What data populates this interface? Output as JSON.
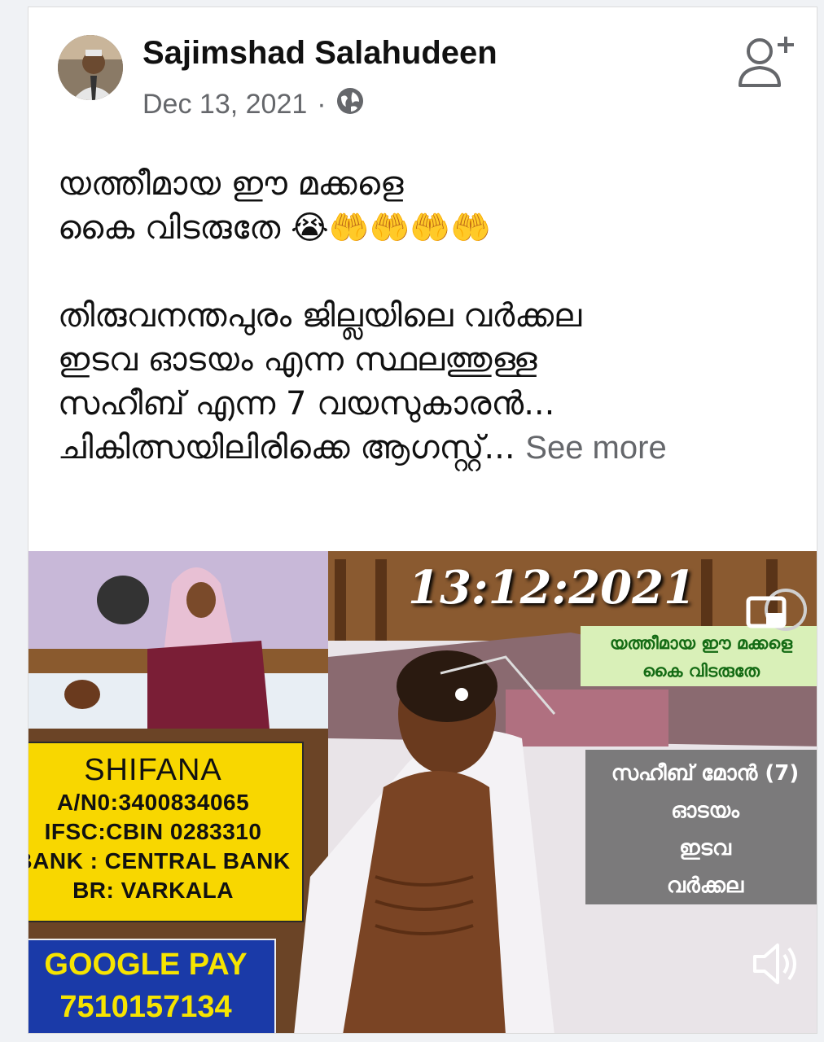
{
  "post": {
    "author": "Sajimshad Salahudeen",
    "date": "Dec 13, 2021",
    "separator": "·",
    "text_lines": [
      "യത്തീമായ ഈ മക്കളെ",
      "കൈ വിടരുതേ 😭🤲🤲🤲🤲",
      "",
      "തിരുവനന്തപുരം ജില്ലയിലെ വർക്കല",
      "ഇടവ ഓടയം എന്ന സ്ഥലത്തുള്ള",
      "സഹീബ് എന്ന 7 വയസുകാരൻ...",
      "ചികിത്സയിലിരിക്കെ ആഗസ്റ്റ്..."
    ],
    "see_more": "See more"
  },
  "media": {
    "date_stamp": "13:12:2021",
    "caption_top": [
      "യത്തീമായ ഈ മക്കളെ",
      "കൈ വിടരുതേ"
    ],
    "caption_side": [
      "സഹീബ് മോൻ (7)",
      "ഓടയം",
      "ഇടവ",
      "വർക്കല"
    ],
    "bank_box": {
      "name": "SHIFANA",
      "lines": [
        "A/N0:3400834065",
        "IFSC:CBIN 0283310",
        "BANK : CENTRAL BANK",
        "BR: VARKALA"
      ]
    },
    "gpay_box": {
      "label": "GOOGLE PAY",
      "number": "7510157134"
    }
  },
  "icons": {
    "globe": "globe-icon",
    "add_friend": "add-friend-icon",
    "volume": "volume-icon",
    "pip": "picture-in-picture-icon"
  },
  "colors": {
    "text_primary": "#111111",
    "text_secondary": "#65676b",
    "yellow_box": "#f8d700",
    "gpay_blue": "#1a3aa8",
    "gpay_text": "#f6e400"
  }
}
